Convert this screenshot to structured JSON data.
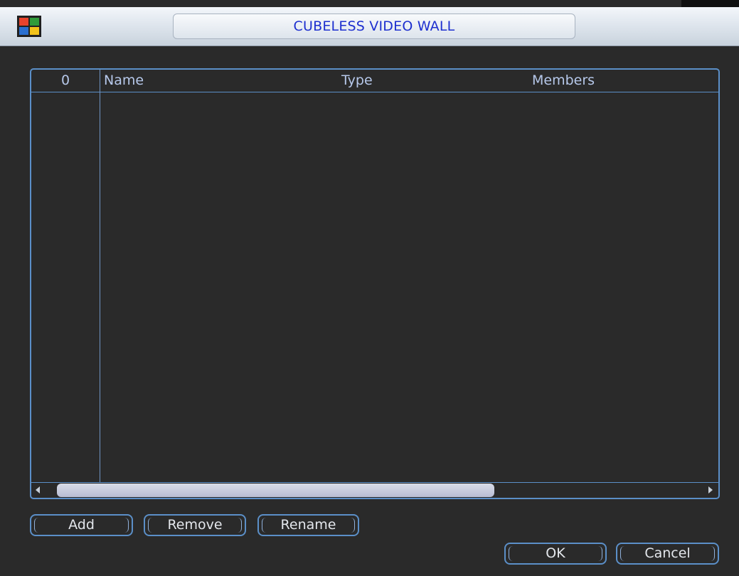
{
  "window": {
    "title": "CUBELESS VIDEO WALL",
    "icon": "video-wall-grid-icon"
  },
  "table": {
    "columns": {
      "index": "0",
      "name": "Name",
      "type": "Type",
      "members": "Members"
    },
    "rows": []
  },
  "buttons": {
    "add": "Add",
    "remove": "Remove",
    "rename": "Rename",
    "ok": "OK",
    "cancel": "Cancel"
  },
  "colors": {
    "background": "#2a2a2a",
    "accent_border": "#5b8fc8",
    "title_text": "#1d2fcf",
    "header_text": "#b6c8ea",
    "button_text": "#e4e7ec"
  }
}
